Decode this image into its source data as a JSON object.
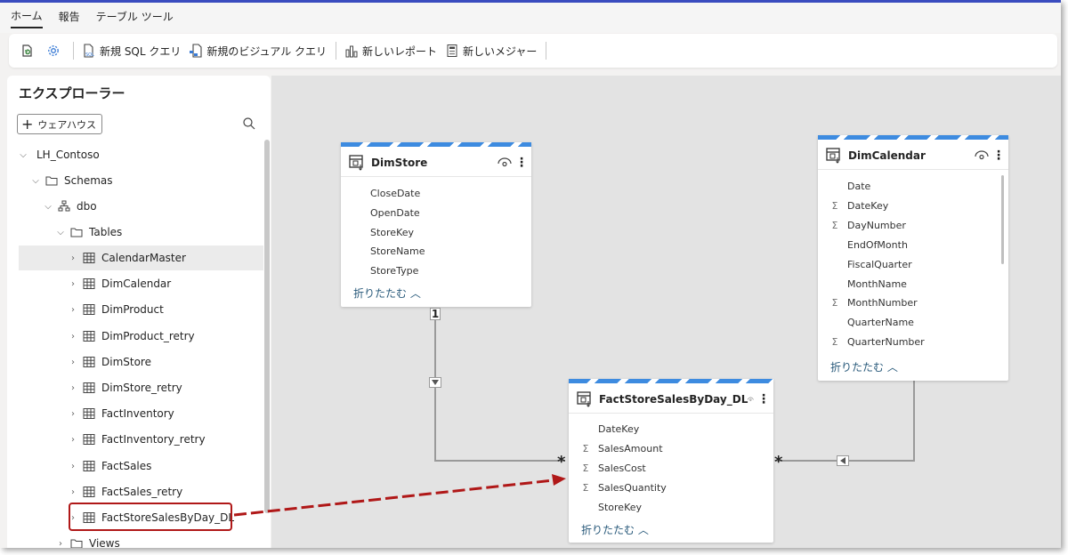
{
  "ribbon": {
    "tabs": [
      "ホーム",
      "報告",
      "テーブル ツール"
    ]
  },
  "toolbar": {
    "new_sql_query": "新規 SQL クエリ",
    "new_visual_query": "新規のビジュアル クエリ",
    "new_report": "新しいレポート",
    "new_measure": "新しいメジャー"
  },
  "explorer": {
    "title": "エクスプローラー",
    "add_warehouse": "ウェアハウス",
    "root": "LH_Contoso",
    "schemas": "Schemas",
    "schema": "dbo",
    "tables_folder": "Tables",
    "tables": [
      "CalendarMaster",
      "DimCalendar",
      "DimProduct",
      "DimProduct_retry",
      "DimStore",
      "DimStore_retry",
      "FactInventory",
      "FactInventory_retry",
      "FactSales",
      "FactSales_retry",
      "FactStoreSalesByDay_DL"
    ],
    "views_folder": "Views"
  },
  "model": {
    "collapse_label": "折りたたむ ︿",
    "dimstore": {
      "name": "DimStore",
      "columns": [
        "CloseDate",
        "OpenDate",
        "StoreKey",
        "StoreName",
        "StoreType"
      ]
    },
    "dimcalendar": {
      "name": "DimCalendar",
      "columns": [
        "Date",
        "DateKey",
        "DayNumber",
        "EndOfMonth",
        "FiscalQuarter",
        "MonthName",
        "MonthNumber",
        "QuarterName",
        "QuarterNumber"
      ],
      "sigma": [
        false,
        true,
        true,
        false,
        false,
        false,
        true,
        false,
        true
      ]
    },
    "fact": {
      "name": "FactStoreSalesByDay_DL",
      "columns": [
        "DateKey",
        "SalesAmount",
        "SalesCost",
        "SalesQuantity",
        "StoreKey"
      ],
      "sigma": [
        false,
        true,
        true,
        true,
        false
      ]
    },
    "relationships": {
      "one": "1",
      "many": "*",
      "sigma_symbol": "Σ"
    }
  },
  "colors": {
    "accent": "#3a4cbf",
    "stripe": "#3d8be0",
    "annotation": "#b01818"
  }
}
